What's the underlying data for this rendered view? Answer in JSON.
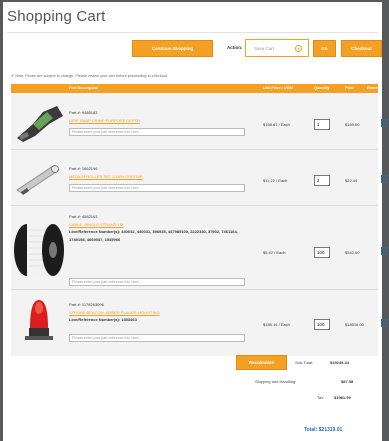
{
  "page": {
    "title": "Shopping Cart"
  },
  "toolbar": {
    "continue_label": "Continue Shopping",
    "actions_label": "Action:",
    "action_select_value": "Save Cart",
    "go_label": "Go",
    "checkout_label": "Checkout"
  },
  "note": "Note: Prices are subject to change. Please review your cart before proceeding to checkout.",
  "table": {
    "headers": [
      "Part Description",
      "Unit Price / UOM",
      "Quantity",
      "Price",
      "Remove"
    ],
    "rows": [
      {
        "part_no": "Part #: 9485183",
        "name": "GRIP SNAP CRIMP PURPOSE DEPTH",
        "reference": "",
        "note_placeholder": "Please enter your part reference info here...",
        "unit_price": "$168.81 / Each",
        "qty": "1",
        "total": "$169.00"
      },
      {
        "part_no": "Part #: 1662196",
        "name": "MEDIUM ROLLER SET 3/16IN GROOVE",
        "reference": "",
        "note_placeholder": "Please enter your part reference info here...",
        "unit_price": "$11.22 / Each",
        "qty": "2",
        "total": "$22.44"
      },
      {
        "part_no": "Part #: 4582163",
        "name": "CABLE, SINGLE STRAND 1M",
        "reference": "Line/Reference Number(s): 440032, 440031, 396935, 447989100, 2222330, 37902, 7461164, 1749198, 4669037, 1535966",
        "note_placeholder": "Please enter your part reference info here...",
        "unit_price": "$5.42 / Each",
        "qty": "100",
        "total": "$542.00"
      },
      {
        "part_no": "Part #: 1178263096",
        "name": "STROBE BEACON, AMBER FLANGE MOUNTING",
        "reference": "Line/Reference Number(s): 1353463",
        "note_placeholder": "Please enter your part reference info here...",
        "unit_price": "$185.16 / Each",
        "qty": "100",
        "total": "$18516.00"
      }
    ]
  },
  "summary": {
    "recalculate_label": "Recalculate",
    "subtotal_label": "Sub-Total:",
    "subtotal_value": "$19249.44",
    "shipping_label": "Shipping and Handling:",
    "shipping_value": "$87.58",
    "tax_label": "Tax:",
    "tax_value": "$1981.99",
    "grand_total": "Total: $21319.01"
  },
  "colors": {
    "accent": "#f4a025",
    "link": "#2a6db5",
    "frame": "#58595b"
  },
  "icons": [
    "trash-icon",
    "chevron-down-icon"
  ]
}
